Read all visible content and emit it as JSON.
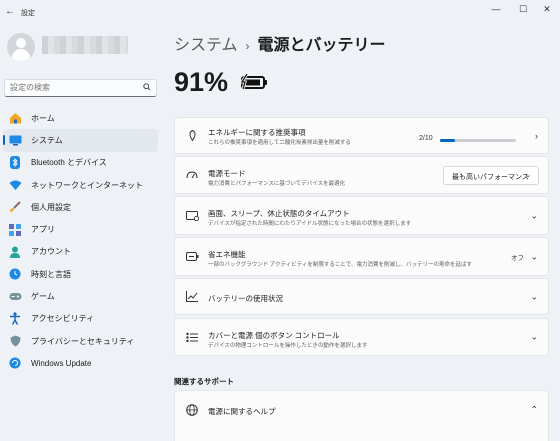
{
  "window": {
    "back_glyph": "←",
    "title": "設定",
    "minimize": "—",
    "maximize": "☐",
    "close": "✕"
  },
  "sidebar": {
    "search_placeholder": "設定の検索",
    "items": [
      {
        "label": "ホーム",
        "icon": "home-icon",
        "active": false
      },
      {
        "label": "システム",
        "icon": "system-icon",
        "active": true
      },
      {
        "label": "Bluetooth とデバイス",
        "icon": "bluetooth-icon",
        "active": false
      },
      {
        "label": "ネットワークとインターネット",
        "icon": "network-icon",
        "active": false
      },
      {
        "label": "個人用設定",
        "icon": "brush-icon",
        "active": false
      },
      {
        "label": "アプリ",
        "icon": "apps-icon",
        "active": false
      },
      {
        "label": "アカウント",
        "icon": "account-icon",
        "active": false
      },
      {
        "label": "時刻と言語",
        "icon": "globe-clock-icon",
        "active": false
      },
      {
        "label": "ゲーム",
        "icon": "gamepad-icon",
        "active": false
      },
      {
        "label": "アクセシビリティ",
        "icon": "accessibility-icon",
        "active": false
      },
      {
        "label": "プライバシーとセキュリティ",
        "icon": "shield-icon",
        "active": false
      },
      {
        "label": "Windows Update",
        "icon": "update-icon",
        "active": false
      }
    ]
  },
  "main": {
    "breadcrumb_parent": "システム",
    "breadcrumb_sep": "›",
    "breadcrumb_current": "電源とバッテリー",
    "battery_percent": "91%",
    "battery_level": 0.91,
    "cards": [
      {
        "title": "エネルギーに関する推奨事項",
        "subtitle": "これらの推奨事項を適用して二酸化炭素排出量を削減する",
        "icon": "leaf-icon",
        "progress_label": "2/10",
        "progress": 0.2,
        "chevron": "›"
      },
      {
        "title": "電源モード",
        "subtitle": "電力消費とパフォーマンスに基づいてデバイスを最適化",
        "icon": "power-mode-icon",
        "select_value": "最も高いパフォーマンス",
        "select_arrow": "⌄"
      },
      {
        "title": "画面、スリープ、休止状態のタイムアウト",
        "subtitle": "デバイスが指定された時間にわたりアイドル状態になった場合の状態を選択します",
        "icon": "screen-sleep-icon",
        "chevron": "⌄"
      },
      {
        "title": "省エネ機能",
        "subtitle": "一部のバックグラウンド アクティビティを制限することで、電力消費を削減し、バッテリーの寿命を延ばす",
        "icon": "energy-saver-icon",
        "status": "オフ",
        "chevron": "⌄"
      },
      {
        "title": "バッテリーの使用状況",
        "icon": "usage-chart-icon",
        "chevron": "⌄"
      },
      {
        "title": "カバーと電源 個のボタン コントロール",
        "subtitle": "デバイスの物理コントロールを操作したときの動作を選択します",
        "icon": "buttons-icon",
        "chevron": "⌄"
      }
    ],
    "related_title": "関連するサポート",
    "help": {
      "title": "電源に関するヘルプ",
      "icon": "globe-icon",
      "chevron": "⌃"
    }
  },
  "colors": {
    "accent": "#0067c0",
    "background": "#eef2f7",
    "card": "#fbfbfc"
  }
}
